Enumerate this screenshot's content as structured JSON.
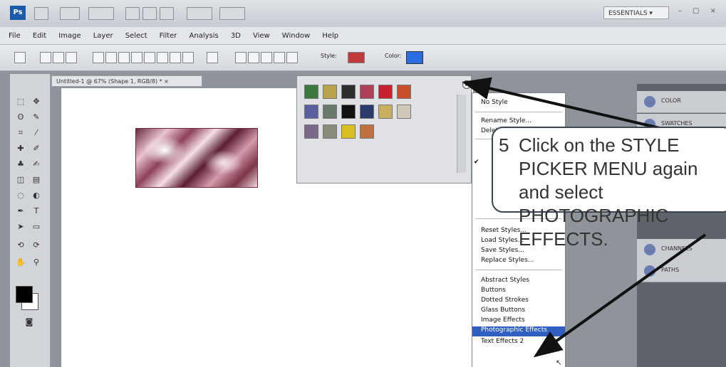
{
  "app": {
    "logo": "Ps",
    "workspace": "ESSENTIALS ▾",
    "window_controls": "– ▢ ×"
  },
  "menu": [
    "File",
    "Edit",
    "Image",
    "Layer",
    "Select",
    "Filter",
    "Analysis",
    "3D",
    "View",
    "Window",
    "Help"
  ],
  "options_bar": {
    "style_label": "Style:",
    "color_label": "Color:",
    "color_value": "#2a6de0"
  },
  "document": {
    "tab_title": "Untitled-1 @ 67% (Shape 1, RGB/8) * ×"
  },
  "style_picker": {
    "swatches": [
      "#3b7a3a",
      "#b9a24a",
      "#2d2d2d",
      "#b0405a",
      "#c8202f",
      "#c8502a",
      "#5a5fa0",
      "#6a7a6a",
      "#111111",
      "#2a3a6a",
      "#c8b060",
      "#d0c8b8",
      "#7a6a8a",
      "#8a8a7a",
      "#d8c020",
      "#c07040"
    ]
  },
  "popup_menu": {
    "items_top": [
      "No Style"
    ],
    "items_styles": [
      "Rename Style...",
      "Delete Style"
    ],
    "items_files": [
      "Reset Styles...",
      "Load Styles...",
      "Save Styles...",
      "Replace Styles..."
    ],
    "items_libraries": [
      "Abstract Styles",
      "Buttons",
      "Dotted Strokes",
      "Glass Buttons",
      "Image Effects",
      "Photographic Effects",
      "Text Effects 2"
    ],
    "highlighted": "Photographic Effects"
  },
  "panels": [
    {
      "label": "COLOR"
    },
    {
      "label": "SWATCHES"
    },
    {
      "label": "CHANNELS"
    },
    {
      "label": "PATHS"
    }
  ],
  "callout": {
    "number": "5",
    "text": "Click on the STYLE PICKER MENU again and select PHOTOGRAPHIC EFFECTS."
  }
}
